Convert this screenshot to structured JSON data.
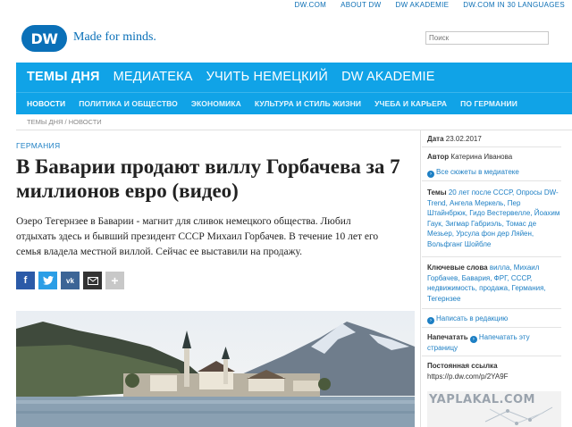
{
  "top_links": [
    "DW.COM",
    "ABOUT DW",
    "DW AKADEMIE",
    "DW.COM IN 30 LANGUAGES"
  ],
  "header": {
    "logo_text": "DW",
    "slogan": "Made for minds.",
    "search_placeholder": "Поиск"
  },
  "nav": {
    "main": [
      "ТЕМЫ ДНЯ",
      "МЕДИАТЕКА",
      "УЧИТЬ НЕМЕЦКИЙ",
      "DW AKADEMIE"
    ],
    "sub": [
      "НОВОСТИ",
      "ПОЛИТИКА И ОБЩЕСТВО",
      "ЭКОНОМИКА",
      "КУЛЬТУРА И СТИЛЬ ЖИЗНИ",
      "УЧЕБА И КАРЬЕРА",
      "ПО ГЕРМАНИИ"
    ]
  },
  "breadcrumb": "ТЕМЫ ДНЯ / НОВОСТИ",
  "article": {
    "kicker": "ГЕРМАНИЯ",
    "title": "В Баварии продают виллу Горбачева за 7 миллионов евро (видео)",
    "lead": "Озеро Тегернзее в Баварии - магнит для сливок немецкого общества. Любил отдыхать здесь и бывший президент СССР Михаил Горбачев. В течение 10 лет его семья владела местной виллой. Сейчас ее выставили на продажу."
  },
  "share": {
    "fb": "f",
    "vk": "vk",
    "more": "+"
  },
  "sidebar": {
    "date_label": "Дата",
    "date_value": "23.02.2017",
    "author_label": "Автор",
    "author_value": "Катерина Иванова",
    "all_stories": "Все сюжеты в медиатеке",
    "topics_label": "Темы",
    "topics_value": "20 лет после СССР, Опросы DW-Trend, Ангела Меркель, Пер Штайнбрюк, Гидо Вестервелле, Йоахим Гаук, Зигмар Габриэль, Томас де Мезьер, Урсула фон дер Ляйен, Вольфганг Шойбле",
    "keywords_label": "Ключевые слова",
    "keywords_value": "вилла, Михаил Горбачев, Бавария, ФРГ, СССР, недвижимость, продажа, Германия, Тегернзее",
    "write_editor": "Написать в редакцию",
    "print_label": "Напечатать",
    "print_link": "Напечатать эту страницу",
    "permalink_label": "Постоянная ссылка",
    "permalink_value": "https://p.dw.com/p/2YA9F"
  },
  "watermark": "YAPLAKAL.COM",
  "colors": {
    "nav_blue": "#10a3e7",
    "link_blue": "#1d7fc4",
    "logo_blue": "#0a70b8"
  }
}
